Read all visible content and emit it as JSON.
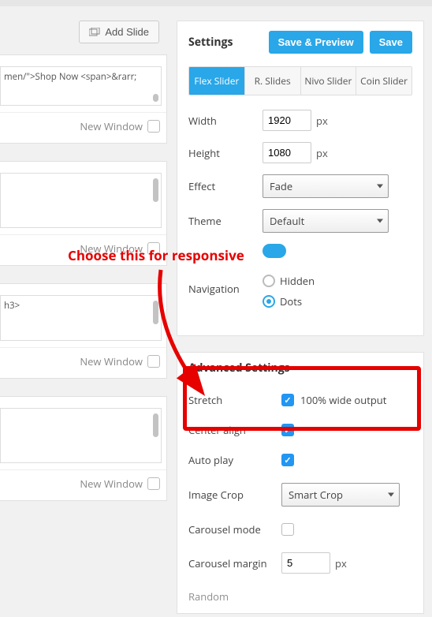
{
  "left": {
    "add_slide_label": "Add Slide",
    "new_window_label": "New Window",
    "slides": [
      {
        "text": "men/\">Shop Now <span>&rarr;"
      },
      {
        "text": ""
      },
      {
        "text": "h3>\n"
      },
      {
        "text": ""
      }
    ]
  },
  "settings": {
    "title": "Settings",
    "save_preview_label": "Save & Preview",
    "save_label": "Save",
    "tabs": [
      "Flex Slider",
      "R. Slides",
      "Nivo Slider",
      "Coin Slider"
    ],
    "active_tab": 0,
    "width": {
      "label": "Width",
      "value": "1920",
      "unit": "px"
    },
    "height": {
      "label": "Height",
      "value": "1080",
      "unit": "px"
    },
    "effect": {
      "label": "Effect",
      "value": "Fade"
    },
    "theme": {
      "label": "Theme",
      "value": "Default"
    },
    "navigation": {
      "label": "Navigation",
      "options": [
        "Hidden",
        "Dots"
      ],
      "selected": 1
    }
  },
  "advanced": {
    "title": "Advanced Settings",
    "stretch": {
      "label": "Stretch",
      "checked": true,
      "text": "100% wide output"
    },
    "center_align": {
      "label": "Center align",
      "checked": true
    },
    "auto_play": {
      "label": "Auto play",
      "checked": true
    },
    "image_crop": {
      "label": "Image Crop",
      "value": "Smart Crop"
    },
    "carousel_mode": {
      "label": "Carousel mode",
      "checked": false
    },
    "carousel_margin": {
      "label": "Carousel margin",
      "value": "5",
      "unit": "px"
    },
    "random": {
      "label": "Random"
    }
  },
  "annotation": {
    "text": "Choose this for responsive"
  }
}
